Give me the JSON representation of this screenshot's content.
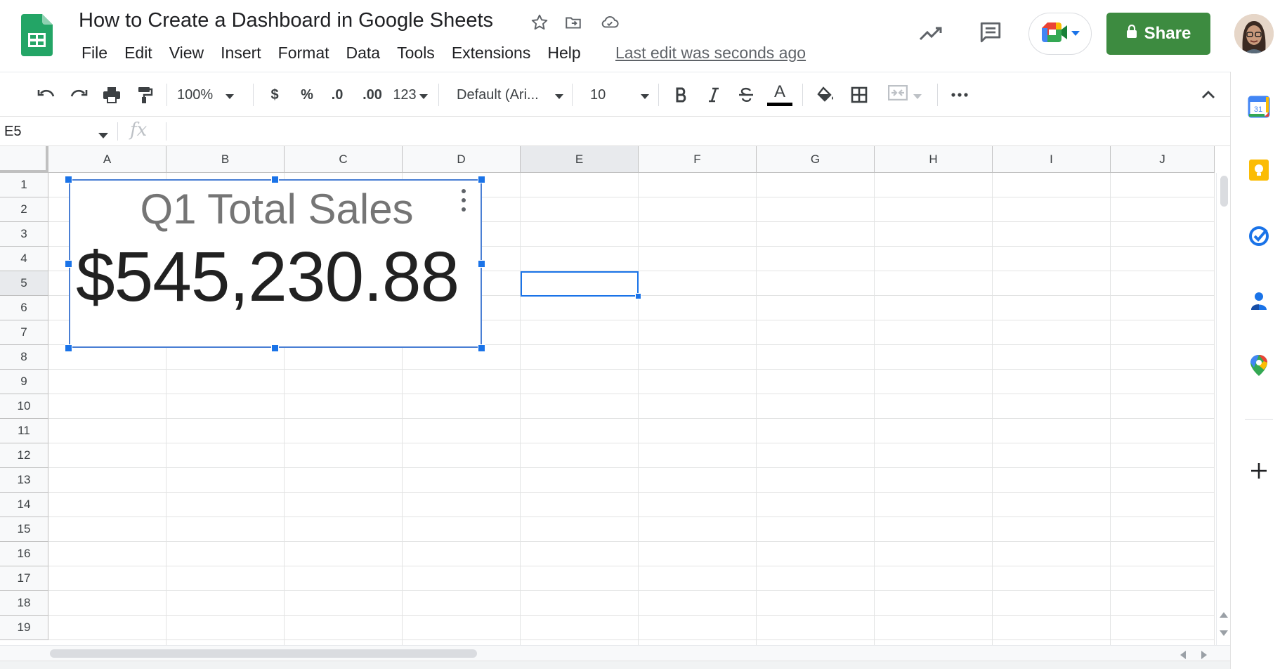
{
  "app": {
    "doc_title": "How to Create a Dashboard in Google Sheets",
    "last_edit": "Last edit was seconds ago",
    "menu": [
      "File",
      "Edit",
      "View",
      "Insert",
      "Format",
      "Data",
      "Tools",
      "Extensions",
      "Help"
    ],
    "share_label": "Share"
  },
  "toolbar": {
    "zoom": "100%",
    "currency": "$",
    "percent": "%",
    "decrease_decimal": ".0",
    "increase_decimal": ".00",
    "more_formats": "123",
    "font": "Default (Ari...",
    "font_size": "10",
    "text_color_letter": "A"
  },
  "formula_bar": {
    "name_box": "E5",
    "fx": "fx",
    "content": ""
  },
  "grid": {
    "columns": [
      "A",
      "B",
      "C",
      "D",
      "E",
      "F",
      "G",
      "H",
      "I",
      "J"
    ],
    "rows": [
      "1",
      "2",
      "3",
      "4",
      "5",
      "6",
      "7",
      "8",
      "9",
      "10",
      "11",
      "12",
      "13",
      "14",
      "15",
      "16",
      "17",
      "18",
      "19"
    ],
    "selected_cell": "E5"
  },
  "scorecard": {
    "title": "Q1 Total Sales",
    "value": "$545,230.88"
  },
  "side_panel": {
    "calendar_day": "31"
  },
  "colors": {
    "share_green": "#3d8b40",
    "selection_blue": "#1a73e8",
    "sheets_green": "#23a566"
  }
}
